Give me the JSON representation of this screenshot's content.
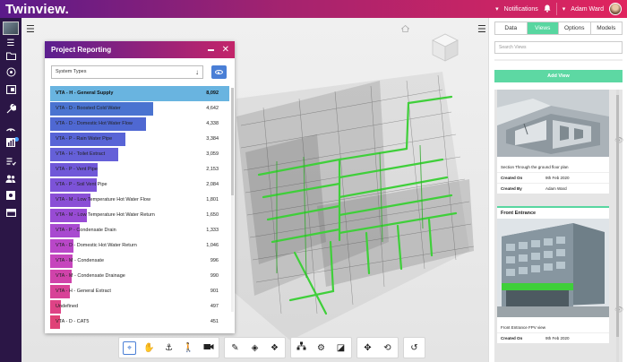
{
  "app": {
    "title": "Twinview."
  },
  "header": {
    "notifications_label": "Notifications",
    "user_name": "Adam Ward"
  },
  "report": {
    "title": "Project Reporting",
    "select_value": "System Types",
    "rows": [
      {
        "label": "VTA - H - General Supply",
        "value": "8,092",
        "pct": 1.0,
        "color": "#69b4e0"
      },
      {
        "label": "VTA - D - Boosted Cold Water",
        "value": "4,642",
        "pct": 0.574,
        "color": "#4a73d0"
      },
      {
        "label": "VTA - D - Domestic Hot Water Flow",
        "value": "4,338",
        "pct": 0.536,
        "color": "#4f68d2"
      },
      {
        "label": "VTA - P - Rain Water Pipe",
        "value": "3,384",
        "pct": 0.418,
        "color": "#5864d6"
      },
      {
        "label": "VTA - H - Toilet Extract",
        "value": "3,059",
        "pct": 0.378,
        "color": "#6560d8"
      },
      {
        "label": "VTA - P - Vent Pipe",
        "value": "2,153",
        "pct": 0.266,
        "color": "#7058d8"
      },
      {
        "label": "VTA - P - Soil Vent Pipe",
        "value": "2,084",
        "pct": 0.258,
        "color": "#7c53d8"
      },
      {
        "label": "VTA - M - Low Temperature Hot Water Flow",
        "value": "1,801",
        "pct": 0.223,
        "color": "#8a4fd6"
      },
      {
        "label": "VTA - M - Low Temperature Hot Water Return",
        "value": "1,650",
        "pct": 0.204,
        "color": "#984bd4"
      },
      {
        "label": "VTA - P - Condensate Drain",
        "value": "1,333",
        "pct": 0.165,
        "color": "#a84ad0"
      },
      {
        "label": "VTA - D - Domestic Hot Water Return",
        "value": "1,046",
        "pct": 0.129,
        "color": "#b947c8"
      },
      {
        "label": "VTA - M - Condensate",
        "value": "996",
        "pct": 0.123,
        "color": "#c645bd"
      },
      {
        "label": "VTA - M - Condensate Drainage",
        "value": "990",
        "pct": 0.122,
        "color": "#d043aa"
      },
      {
        "label": "VTA - H - General Extract",
        "value": "901",
        "pct": 0.111,
        "color": "#d84297"
      },
      {
        "label": "Undefined",
        "value": "497",
        "pct": 0.061,
        "color": "#de4386"
      },
      {
        "label": "VTA - D - CAT5",
        "value": "451",
        "pct": 0.056,
        "color": "#e04277"
      }
    ]
  },
  "right_panel": {
    "tabs": [
      "Data",
      "Views",
      "Options",
      "Models"
    ],
    "active_tab": "Views",
    "search_placeholder": "Search Views",
    "add_view_label": "Add View",
    "card1": {
      "caption": "Section Through the ground floor plan",
      "created_on_label": "Created On",
      "created_on_value": "9th Feb 2020",
      "created_by_label": "Created By",
      "created_by_value": "Adam Ward"
    },
    "card2": {
      "title": "Front Entrance",
      "caption": "Front Entrance FPV view",
      "created_on_label": "Created On",
      "created_on_value": "9th Feb 2020"
    }
  },
  "colors": {
    "accent_green": "#58d6a0",
    "accent_blue": "#4a7fd6",
    "header_start": "#5a1a8a",
    "header_end": "#e0245e"
  },
  "icons": {
    "sidebar": [
      "folder-icon",
      "target-icon",
      "layers-icon",
      "wrench-icon",
      "sensor-icon",
      "chart-icon",
      "checklist-icon",
      "users-icon",
      "settings-icon",
      "storage-icon"
    ],
    "toolbar": [
      "select-icon",
      "pan-icon",
      "anchor-icon",
      "walk-icon",
      "camera-icon",
      "pencil-icon",
      "section-icon",
      "explode-icon",
      "tree-icon",
      "gear-icon",
      "measure-icon",
      "move-icon",
      "orbit-icon",
      "reset-icon"
    ]
  }
}
